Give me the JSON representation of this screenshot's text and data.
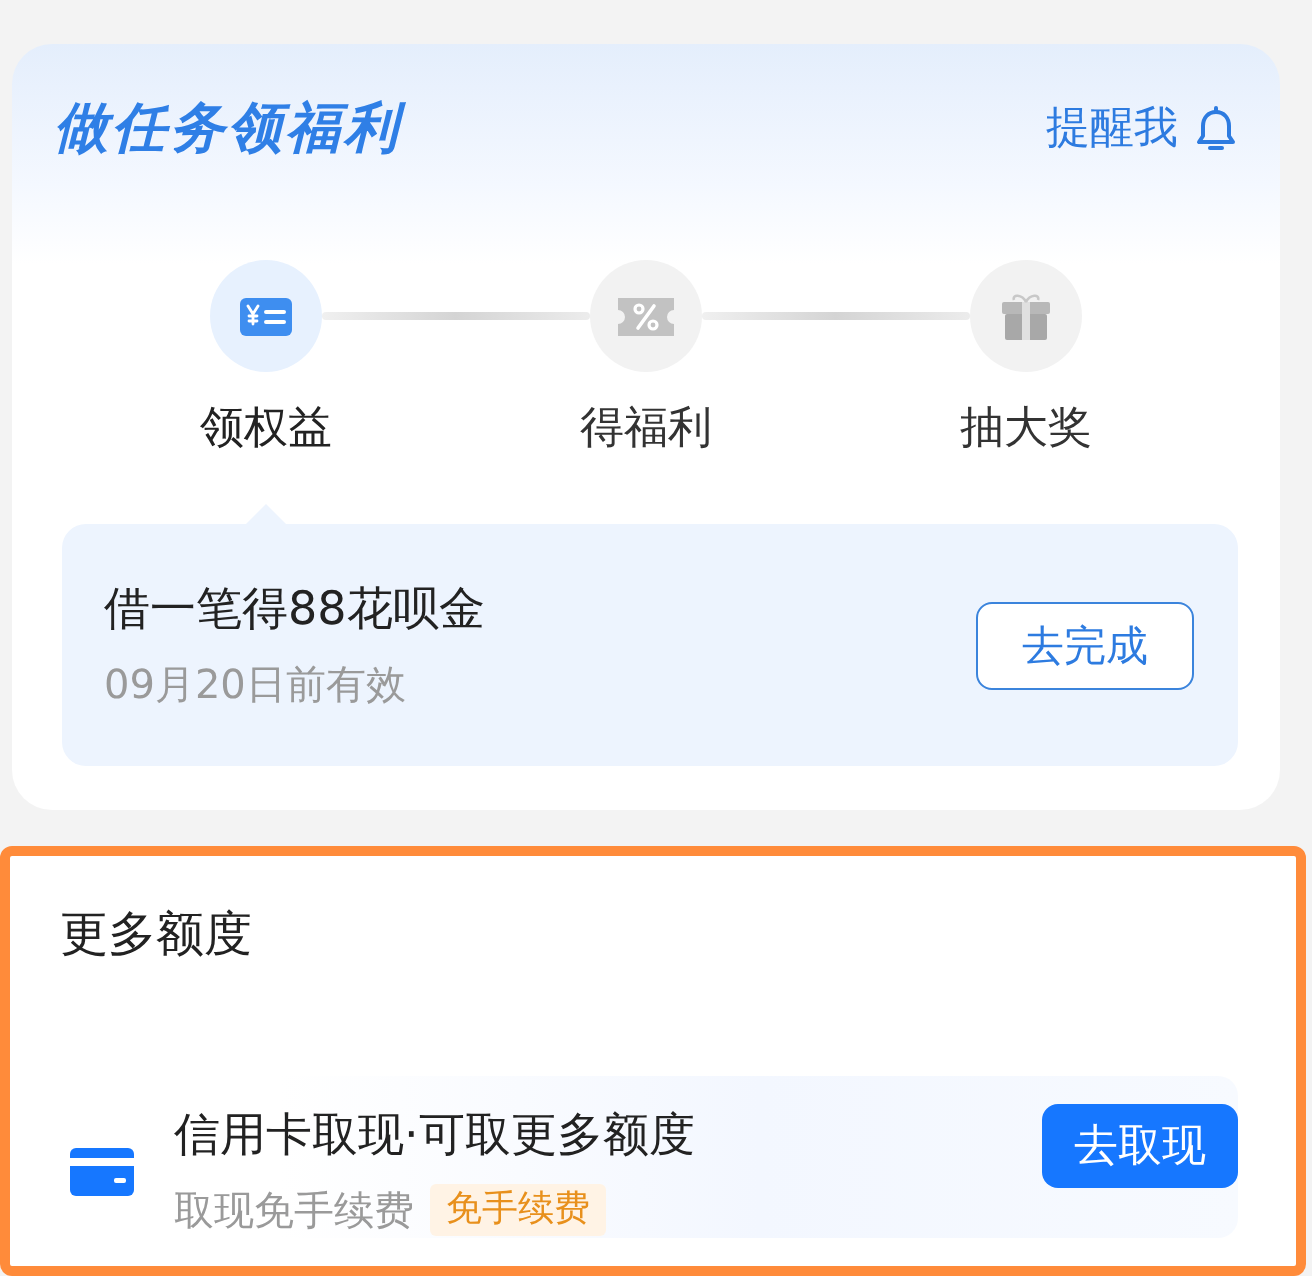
{
  "task_card": {
    "title": "做任务领福利",
    "remind": {
      "label": "提醒我"
    },
    "steps": [
      {
        "label": "领权益",
        "kind": "coupon",
        "selected": true
      },
      {
        "label": "得福利",
        "kind": "discount",
        "selected": false
      },
      {
        "label": "抽大奖",
        "kind": "gift",
        "selected": false
      }
    ],
    "task": {
      "title": "借一笔得88花呗金",
      "expiry": "09月20日前有效",
      "button": "去完成"
    }
  },
  "more_quota": {
    "title": "更多额度",
    "items": [
      {
        "title": "信用卡取现·可取更多额度",
        "subtitle": "取现免手续费",
        "tag": "免手续费",
        "button": "去取现"
      }
    ]
  }
}
